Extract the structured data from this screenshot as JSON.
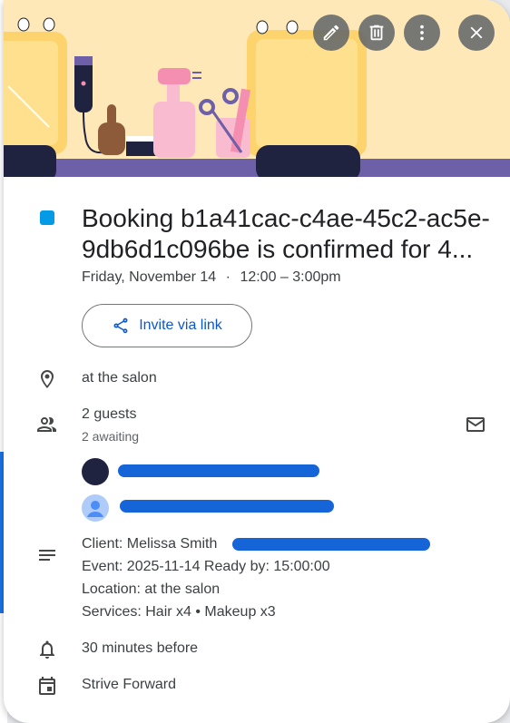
{
  "header": {
    "edit_icon": "pencil-icon",
    "delete_icon": "trash-icon",
    "more_icon": "more-vert-icon",
    "close_icon": "close-icon"
  },
  "event": {
    "color": "#039be5",
    "title_line1": "Booking b1a41cac-c4ae-45c2-ac5e-",
    "title_line2": "9db6d1c096be is confirmed for 4...",
    "date": "Friday, November 14",
    "separator": "·",
    "time": "12:00 – 3:00pm"
  },
  "invite": {
    "label": "Invite via link"
  },
  "location": {
    "text": "at the salon"
  },
  "guests": {
    "count": "2 guests",
    "status": "2 awaiting"
  },
  "description": {
    "line1": "Client: Melissa Smith",
    "line2": "Event: 2025-11-14 Ready by: 15:00:00",
    "line3": "Location: at the salon",
    "line4": "Services: Hair x4 • Makeup x3"
  },
  "reminder": {
    "text": "30 minutes before"
  },
  "calendar": {
    "name": "Strive Forward"
  },
  "colors": {
    "accent": "#0b57d0",
    "redaction": "#1565d8"
  }
}
